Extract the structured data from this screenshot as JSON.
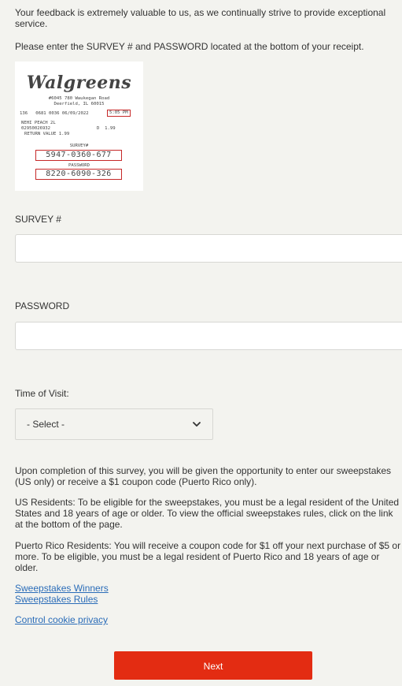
{
  "intro": {
    "feedback_text": "Your feedback is extremely valuable to us, as we continually strive to provide exceptional service.",
    "instruction_text": "Please enter the SURVEY # and PASSWORD located at the bottom of your receipt."
  },
  "receipt": {
    "logo_text": "Walgreens",
    "address_line1": "#6045 780 Waukegan Road",
    "address_line2": "Deerfield, IL 60015",
    "store_line": "136   0681 0036 06/09/2022",
    "time": "5:05 PM",
    "item_line1": "NEHI PEACH 2L",
    "item_line2": "02950026932",
    "item_line2b": "D  1.99",
    "item_line3": "RETURN VALUE 1.99",
    "survey_label": "SURVEY#",
    "survey_number": "5947-0360-677",
    "password_label": "PASSWORD",
    "password_number": "8220-6090-326",
    "highlight_color": "#c62828"
  },
  "form": {
    "survey_label": "SURVEY #",
    "survey_value": "",
    "password_label": "PASSWORD",
    "password_value": "",
    "time_label": "Time of Visit:",
    "time_selected": "- Select -"
  },
  "info": {
    "completion_text": "Upon completion of this survey, you will be given the opportunity to enter our sweepstakes (US only) or receive a $1 coupon code (Puerto Rico only).",
    "us_text": "US Residents: To be eligible for the sweepstakes, you must be a legal resident of the United States and 18 years of age or older. To view the official sweepstakes rules, click on the link at the bottom of the page.",
    "pr_text": "Puerto Rico Residents: You will receive a coupon code for $1 off your next purchase of $5 or more. To be eligible, you must be a legal resident of Puerto Rico and 18 years of age or older."
  },
  "links": {
    "winners": "Sweepstakes Winners",
    "rules": "Sweepstakes Rules",
    "cookie": "Control cookie privacy"
  },
  "actions": {
    "next_label": "Next"
  },
  "colors": {
    "background": "#f3f3ef",
    "link": "#2a6cb8",
    "primary_button": "#e32c12"
  },
  "icons": {
    "select_chevron": "chevron-down-icon"
  }
}
